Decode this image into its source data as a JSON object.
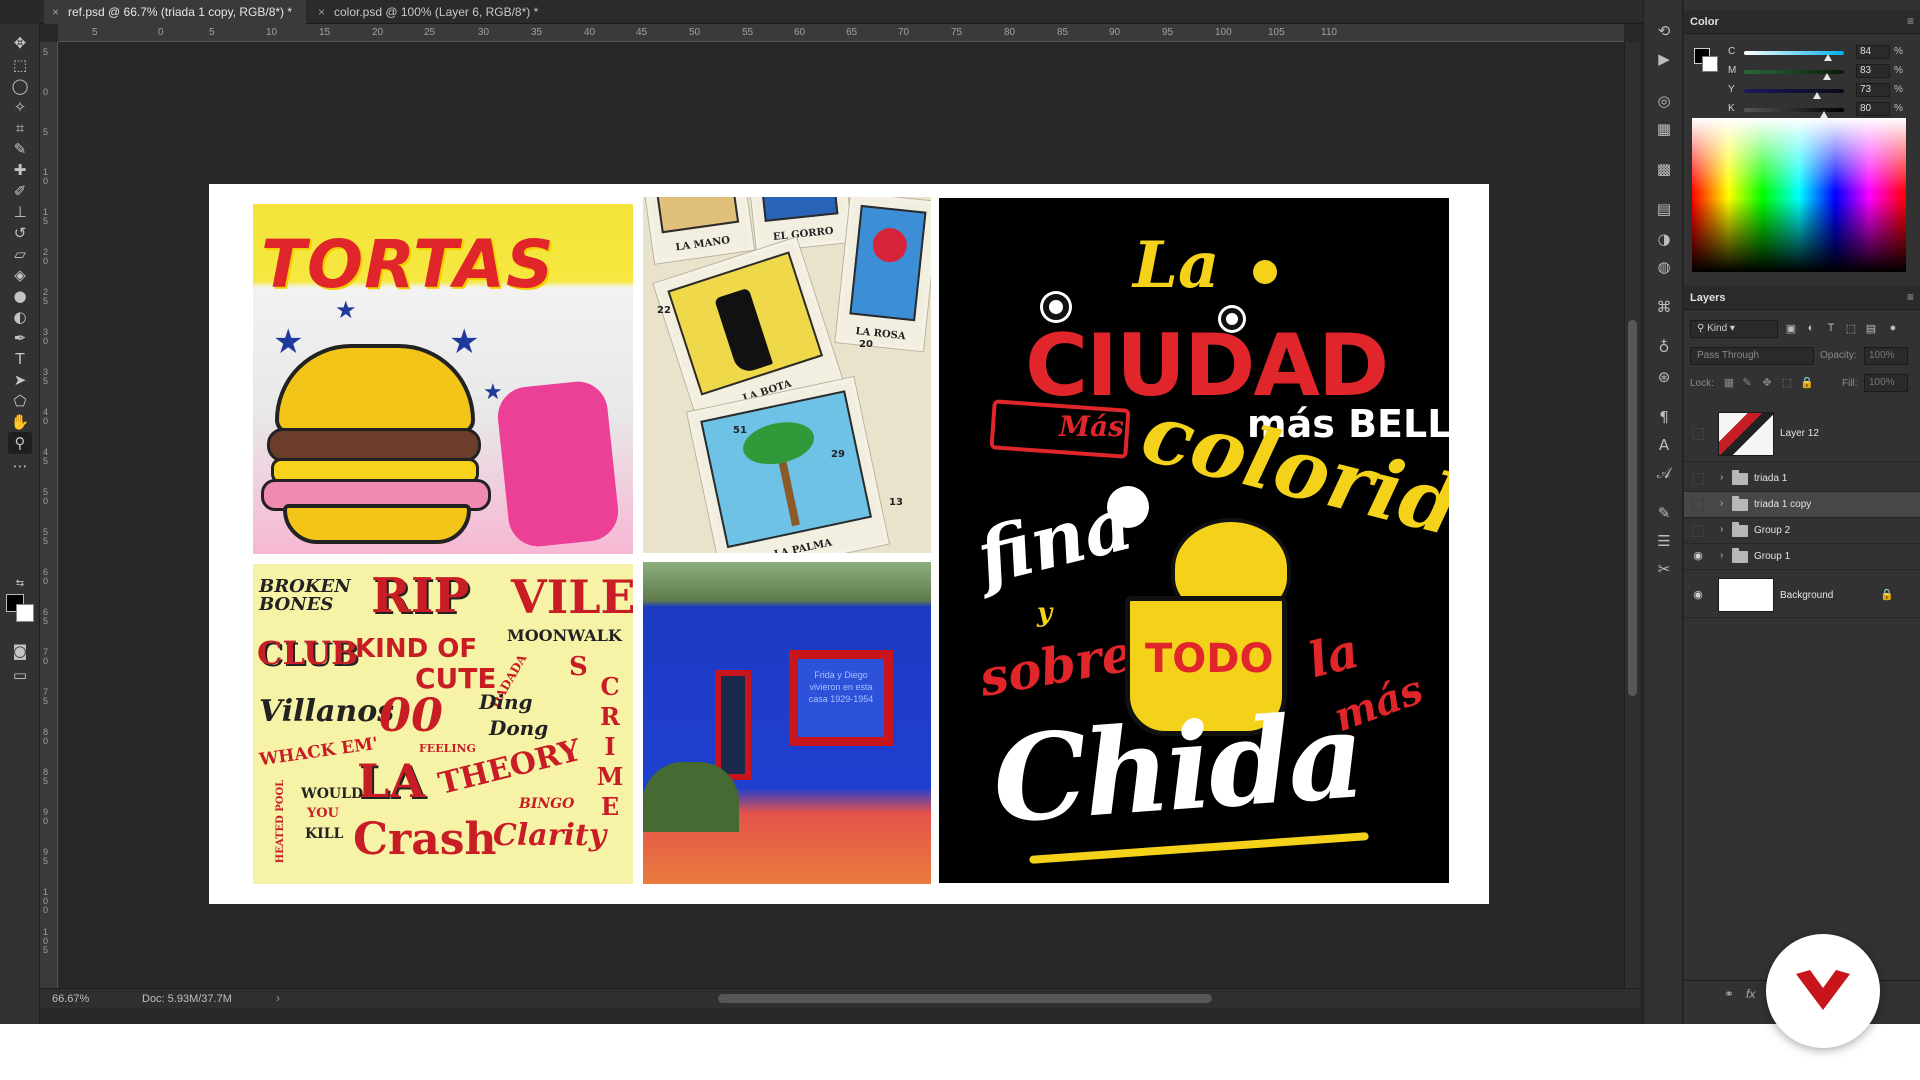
{
  "tabs": [
    {
      "label": "ref.psd @ 66.7% (triada 1 copy, RGB/8*) *",
      "active": true
    },
    {
      "label": "color.psd @ 100% (Layer 6, RGB/8*) *",
      "active": false
    }
  ],
  "close_glyph": "×",
  "ruler_top_labels": [
    "5",
    "0",
    "5",
    "10",
    "15",
    "20",
    "25",
    "30",
    "35",
    "40",
    "45",
    "50",
    "55",
    "60",
    "65",
    "70",
    "75",
    "80",
    "85",
    "90",
    "95",
    "100",
    "105",
    "110"
  ],
  "ruler_left_labels": [
    "5",
    "0",
    "5",
    "1 0",
    "1 5",
    "2 0",
    "2 5",
    "3 0",
    "3 5",
    "4 0",
    "4 5",
    "5 0",
    "5 5",
    "6 0",
    "6 5",
    "7 0",
    "7 5",
    "8 0",
    "8 5",
    "9 0",
    "9 5",
    "1 0 0",
    "1 0 5"
  ],
  "tools": [
    "move-icon",
    "marquee-icon",
    "lasso-icon",
    "magic-wand-icon",
    "crop-icon",
    "eyedropper-icon",
    "healing-icon",
    "brush-icon",
    "stamp-icon",
    "history-brush-icon",
    "eraser-icon",
    "paint-bucket-icon",
    "blur-icon",
    "dodge-icon",
    "pen-icon",
    "type-icon",
    "path-selection-icon",
    "shape-icon",
    "hand-icon",
    "zoom-icon",
    "more-tools-icon"
  ],
  "artwork": {
    "tortas_title": "TORTAS",
    "loteria_cards": [
      "LA MANO",
      "EL GORRO",
      "LA BOTA",
      "LA ROSA",
      "LA PALMA"
    ],
    "loteria_numbers": [
      "22",
      "51",
      "20",
      "29",
      "13"
    ],
    "lettering_words": [
      "BROKEN BONES",
      "RIP",
      "VILE",
      "CLUB",
      "KIND OF",
      "CUTE",
      "MOONWALK",
      "Villanos",
      "DADADA",
      "S",
      "Ding",
      "Dong",
      "00",
      "WHACK EM'",
      "FEELING",
      "LA",
      "THEORY",
      "HEATED POOL",
      "WOULD",
      "YOU",
      "KILL",
      "Crash",
      "BINGO",
      "Clarity",
      "CRIME"
    ],
    "bluehouse_text": "Frida y Diego vivieron en esta casa 1929-1954",
    "poster_words": {
      "la": "La",
      "ciudad": "CIUDAD",
      "mas_small": "Más",
      "mas_bella": "más BELLA,",
      "colorida": "colorida",
      "fina": "fina",
      "y": "y",
      "sobre": "sobre",
      "todo": "TODO",
      "la2": "la",
      "mas2": "más",
      "chida": "Chida"
    }
  },
  "status": {
    "zoom": "66.67%",
    "doc": "Doc: 5.93M/37.7M",
    "arrow": "›"
  },
  "color_panel": {
    "title": "Color",
    "menu": "≡",
    "channels": [
      {
        "label": "C",
        "value": "84",
        "pct": "%",
        "level": 0.84,
        "track": "linear-gradient(90deg,#fff,#00aeef)"
      },
      {
        "label": "M",
        "value": "83",
        "pct": "%",
        "level": 0.83,
        "track": "linear-gradient(90deg,#2a6a3a,#0a1a0a)"
      },
      {
        "label": "Y",
        "value": "73",
        "pct": "%",
        "level": 0.73,
        "track": "linear-gradient(90deg,#1a1a5a,#0a0a1a)"
      },
      {
        "label": "K",
        "value": "80",
        "pct": "%",
        "level": 0.8,
        "track": "linear-gradient(90deg,#555,#000)"
      }
    ]
  },
  "layers_panel": {
    "title": "Layers",
    "menu": "≡",
    "filter_label": "Kind",
    "blend_mode": "Pass Through",
    "opacity_label": "Opacity:",
    "opacity_value": "100%",
    "lock_label": "Lock:",
    "fill_label": "Fill:",
    "fill_value": "100%",
    "layers": [
      {
        "name": "Layer 12",
        "type": "image",
        "visible": false,
        "selected": false
      },
      {
        "name": "triada 1",
        "type": "group",
        "visible": false,
        "selected": false
      },
      {
        "name": "triada 1 copy",
        "type": "group",
        "visible": false,
        "selected": true
      },
      {
        "name": "Group 2",
        "type": "group",
        "visible": false,
        "selected": false
      },
      {
        "name": "Group 1",
        "type": "group",
        "visible": true,
        "selected": false
      },
      {
        "name": "Background",
        "type": "background",
        "visible": true,
        "selected": false
      }
    ],
    "footer_icons": [
      "link-icon",
      "fx-icon"
    ],
    "footer_fx": "fx"
  },
  "colors": {
    "app_bg": "#282828",
    "panel_bg": "#323232",
    "selected_row": "#474747",
    "brand_red": "#c8151c"
  }
}
